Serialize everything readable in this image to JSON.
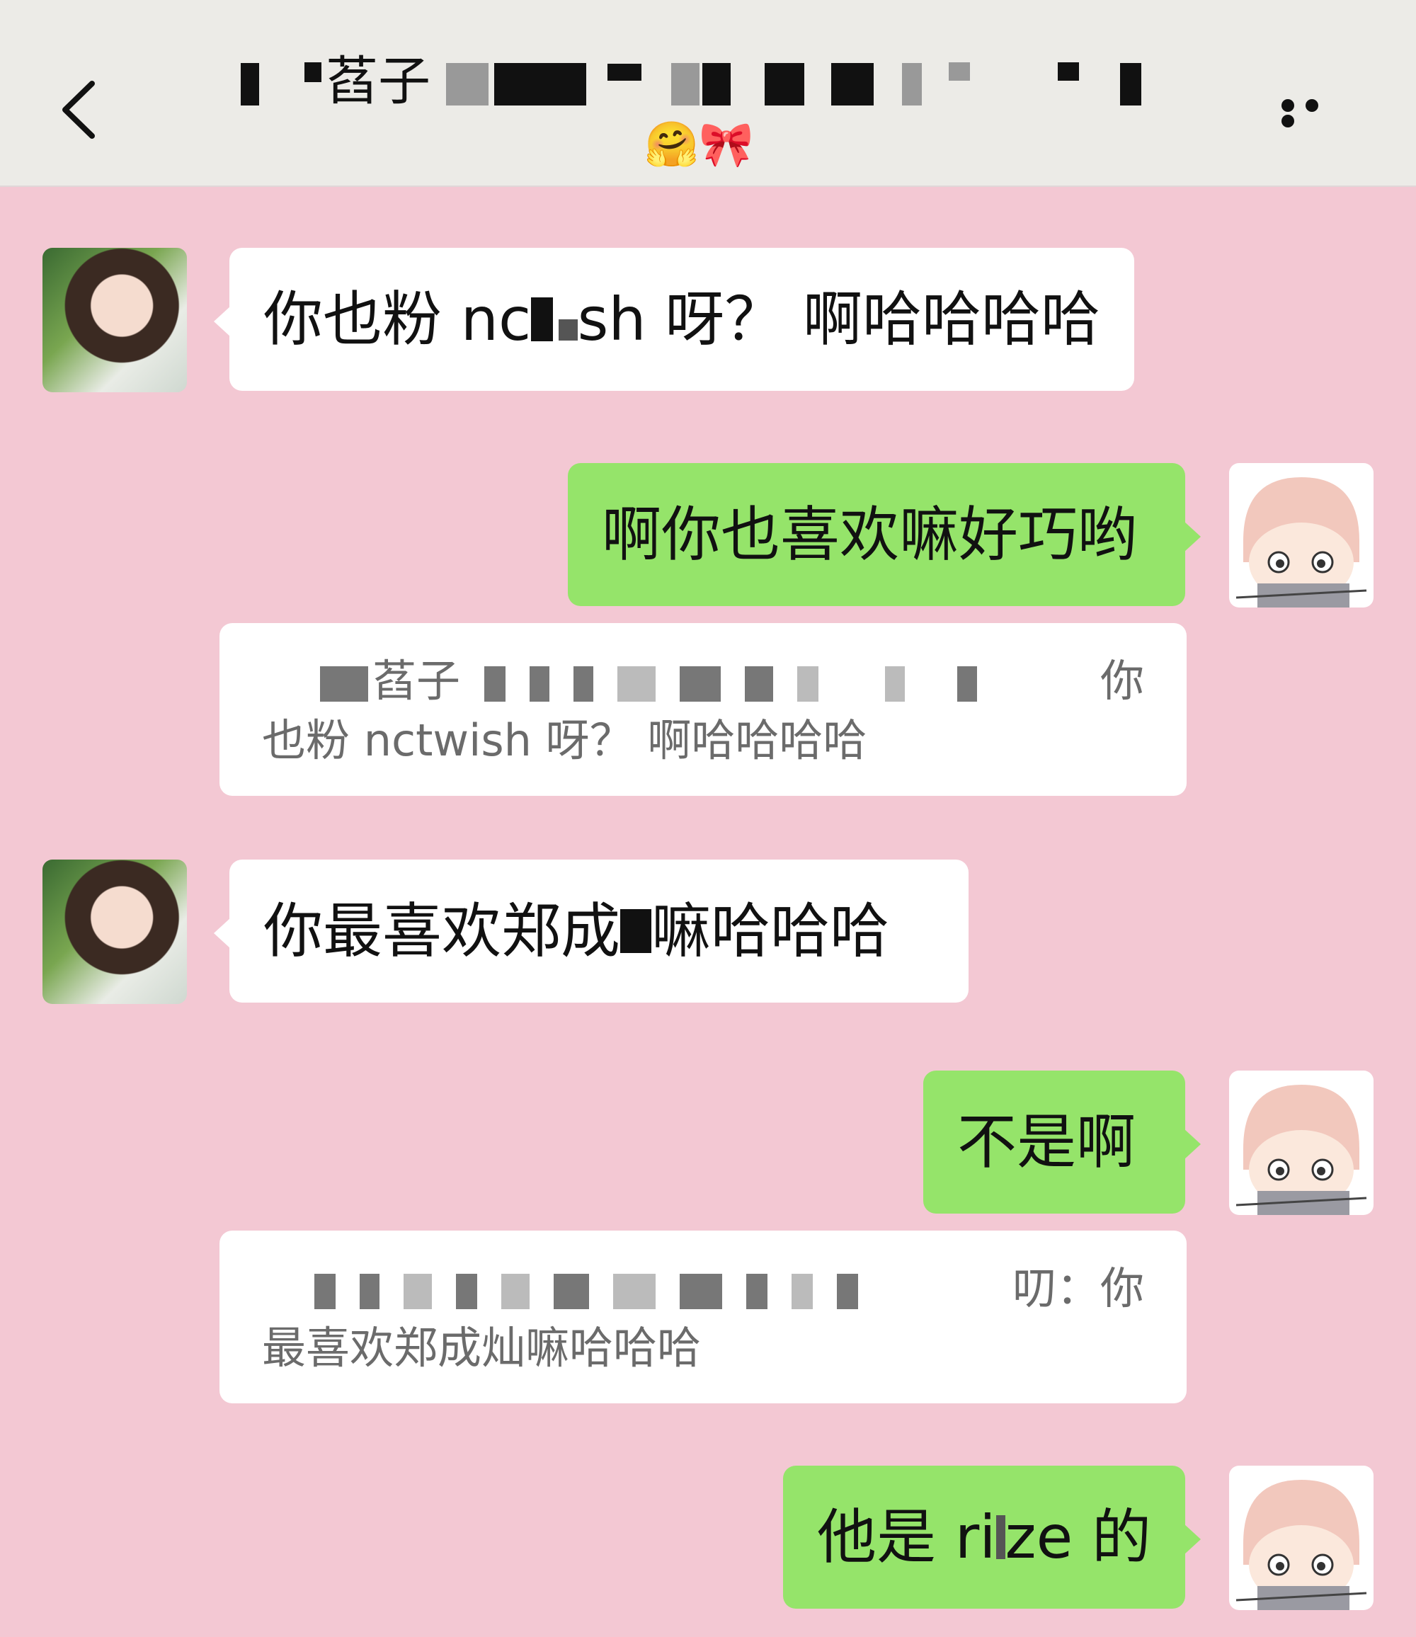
{
  "header": {
    "title_visible": "萏子",
    "subtitle_emojis": "🤗🎀",
    "back_icon": "chevron-left-icon",
    "more_icon": "more-dots-icon"
  },
  "messages": [
    {
      "side": "in",
      "text_before": "你也粉 nc",
      "text_after": "sh 呀？ 啊哈哈哈哈"
    },
    {
      "side": "out",
      "text": "啊你也喜欢嘛好巧哟"
    },
    {
      "side": "quote",
      "line1_tail": "你",
      "line1_frag": "萏子",
      "line2": "也粉 nctwish 呀？ 啊哈哈哈哈"
    },
    {
      "side": "in",
      "text_before": "你最喜欢郑成",
      "text_after": "嘛哈哈哈"
    },
    {
      "side": "out",
      "text": "不是啊"
    },
    {
      "side": "quote",
      "line1_tail": "叨：你",
      "line2": "最喜欢郑成灿嘛哈哈哈"
    },
    {
      "side": "out",
      "text_before": "他是 ri",
      "text_after": "ze 的"
    }
  ]
}
